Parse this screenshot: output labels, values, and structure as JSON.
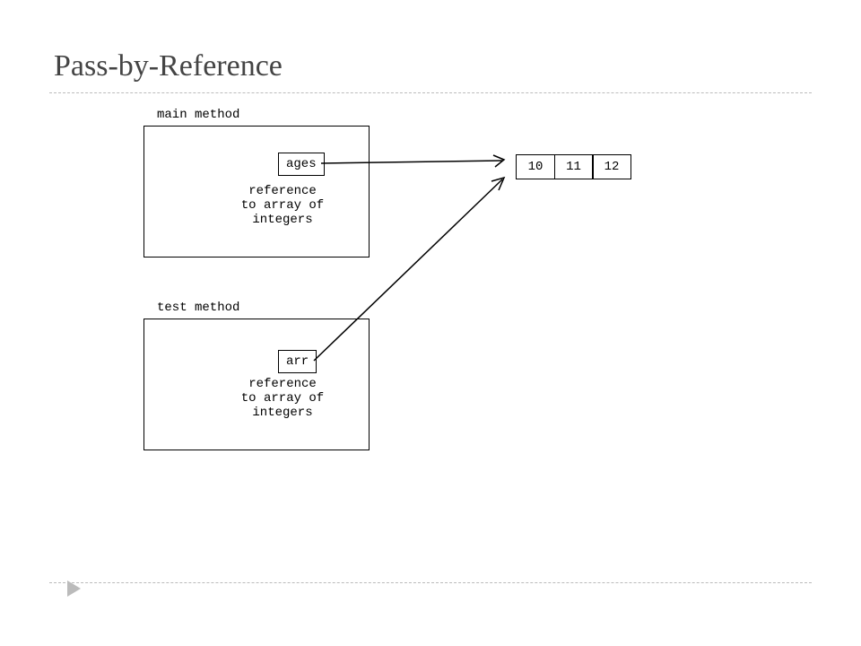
{
  "title": "Pass-by-Reference",
  "mainMethod": {
    "label": "main method",
    "var": "ages",
    "desc1": "reference",
    "desc2": "to array of",
    "desc3": "integers"
  },
  "testMethod": {
    "label": "test method",
    "var": "arr",
    "desc1": "reference",
    "desc2": "to array of",
    "desc3": "integers"
  },
  "array": {
    "v0": "10",
    "v1": "11",
    "v2": "12"
  }
}
